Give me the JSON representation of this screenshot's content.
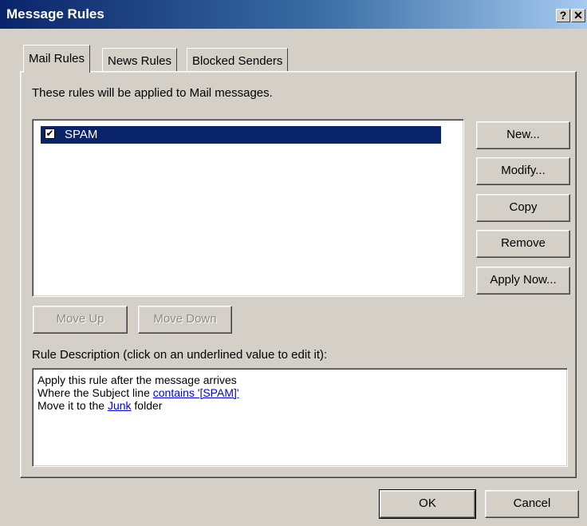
{
  "window": {
    "title": "Message Rules",
    "help_glyph": "?",
    "close_glyph": "✕"
  },
  "tabs": [
    {
      "label": "Mail Rules",
      "active": true
    },
    {
      "label": "News Rules",
      "active": false
    },
    {
      "label": "Blocked Senders",
      "active": false
    }
  ],
  "intro_text": "These rules will be applied to Mail messages.",
  "rules": [
    {
      "name": "SPAM",
      "checked": true,
      "selected": true
    }
  ],
  "side_buttons": {
    "new": "New...",
    "modify": "Modify...",
    "copy": "Copy",
    "remove": "Remove",
    "apply_now": "Apply Now..."
  },
  "move_buttons": {
    "up": "Move Up",
    "down": "Move Down"
  },
  "description": {
    "label": "Rule Description (click on an underlined value to edit it):",
    "line1": "Apply this rule after the message arrives",
    "line2_prefix": "Where the Subject line ",
    "line2_link": "contains '[SPAM]'",
    "line3_prefix": "Move it to the ",
    "line3_link": "Junk",
    "line3_suffix": " folder"
  },
  "footer": {
    "ok": "OK",
    "cancel": "Cancel"
  },
  "colors": {
    "selection": "#0a246a",
    "face": "#d4d0c8",
    "link": "#0000ee"
  }
}
